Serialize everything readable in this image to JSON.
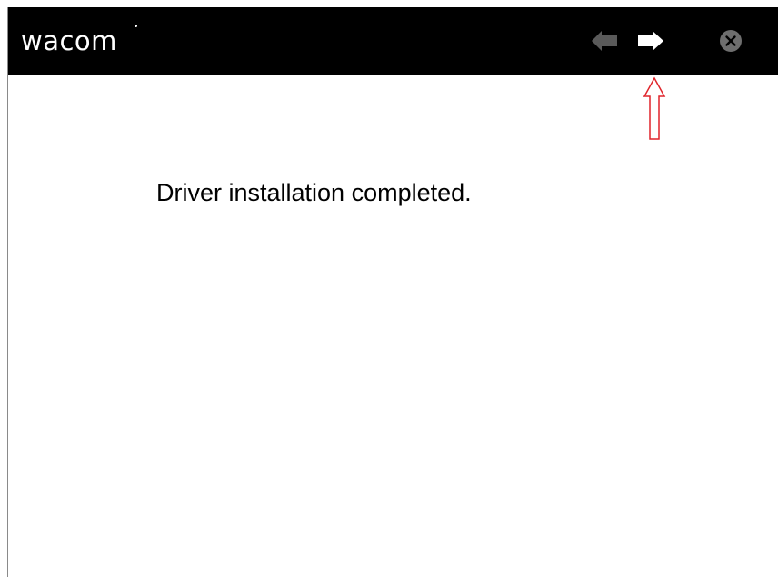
{
  "window": {
    "brand": "wacom",
    "nav": {
      "back_icon": "arrow-left-icon",
      "next_icon": "arrow-right-icon",
      "close_icon": "close-circle-icon"
    }
  },
  "main": {
    "message": "Driver installation completed."
  },
  "annotation": {
    "icon": "arrow-up-outline-icon",
    "color": "#e0242b"
  },
  "colors": {
    "titlebar": "#000000",
    "back_disabled": "#5a5a5a",
    "next_active": "#ffffff",
    "close": "#6e6e6e"
  }
}
